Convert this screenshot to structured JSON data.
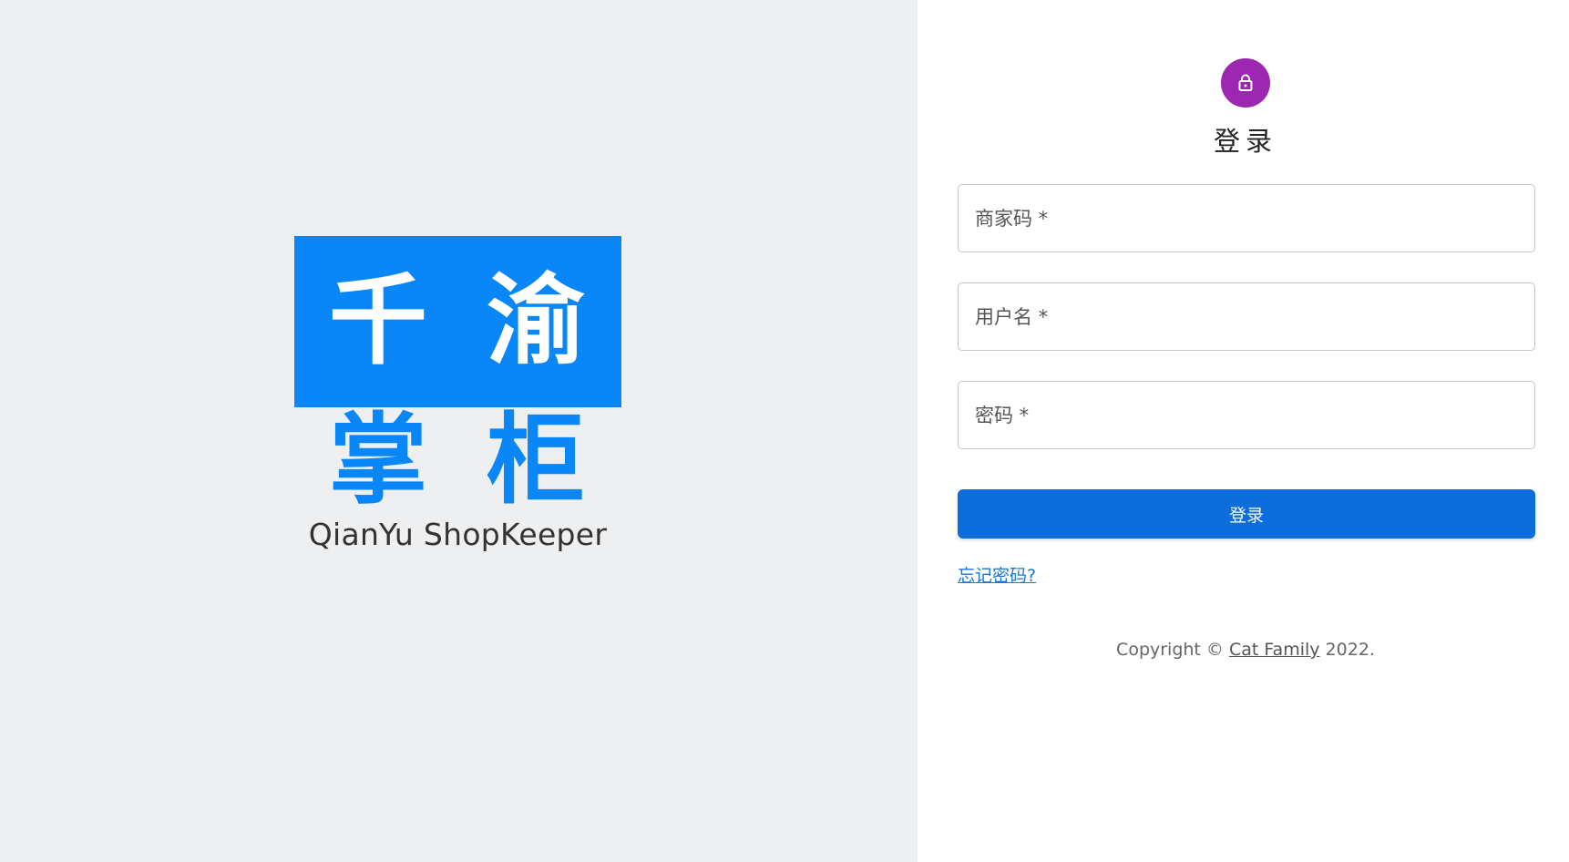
{
  "brand": {
    "logo_top_left": "千",
    "logo_top_right": "渝",
    "logo_bottom_left": "掌",
    "logo_bottom_right": "柜",
    "caption": "QianYu ShopKeeper"
  },
  "login": {
    "icon": "lock-icon",
    "title": "登录",
    "merchant_code_placeholder": "商家码 *",
    "username_placeholder": "用户名 *",
    "password_placeholder": "密码 *",
    "submit_label": "登录",
    "forgot_password": "忘记密码?"
  },
  "footer": {
    "copyright_prefix": "Copyright © ",
    "owner": "Cat Family",
    "copyright_suffix": " 2022."
  },
  "colors": {
    "brand_blue": "#0986f7",
    "avatar_purple": "#9c27b0",
    "button_blue": "#0d6ddd",
    "link_blue": "#1976d2"
  }
}
